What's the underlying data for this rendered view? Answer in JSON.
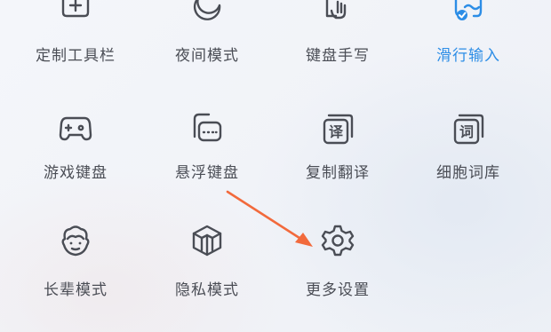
{
  "tools": [
    {
      "label": "定制工具栏",
      "icon": "customize-toolbar-icon"
    },
    {
      "label": "夜间模式",
      "icon": "moon-icon"
    },
    {
      "label": "键盘手写",
      "icon": "handwriting-icon"
    },
    {
      "label": "滑行输入",
      "icon": "swipe-input-icon",
      "active": true
    },
    {
      "label": "游戏键盘",
      "icon": "gamepad-icon"
    },
    {
      "label": "悬浮键盘",
      "icon": "floating-keyboard-icon"
    },
    {
      "label": "复制翻译",
      "icon": "translate-icon",
      "glyph": "译"
    },
    {
      "label": "细胞词库",
      "icon": "lexicon-icon",
      "glyph": "词"
    },
    {
      "label": "长辈模式",
      "icon": "elder-face-icon"
    },
    {
      "label": "隐私模式",
      "icon": "privacy-cube-icon"
    },
    {
      "label": "更多设置",
      "icon": "gear-icon"
    }
  ],
  "colors": {
    "text": "#4a4d55",
    "active": "#2c8de6",
    "arrow": "#f26a3c"
  }
}
